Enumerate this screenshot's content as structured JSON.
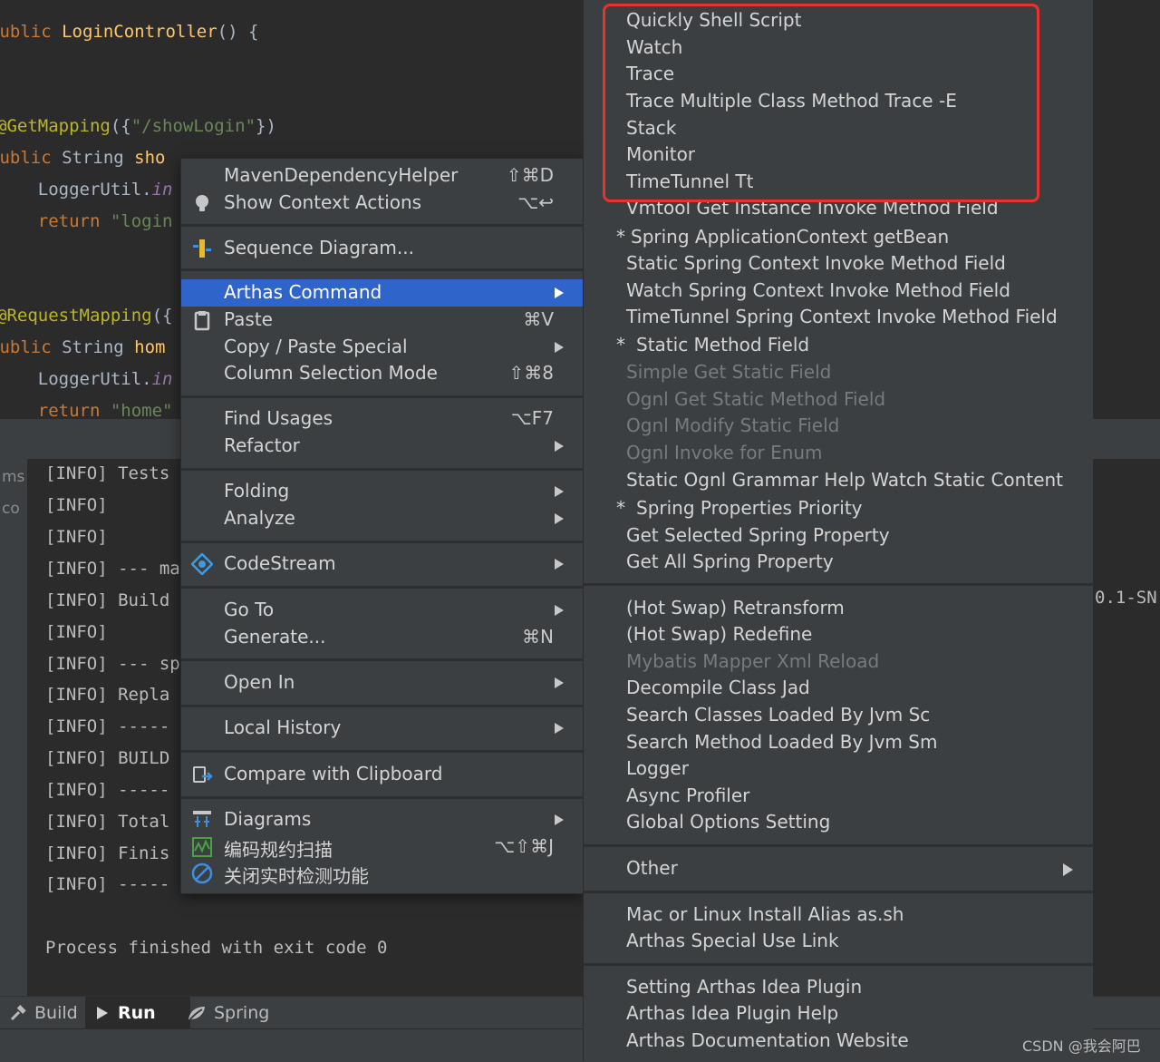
{
  "editor": {
    "lines": [
      {
        "a": "public ",
        "b": "LoginController",
        "c": "() {"
      },
      {
        "text": "}"
      },
      {
        "a": "@GetMapping",
        "b": "({",
        "c": "\"/showLogin\"",
        "d": "})"
      },
      {
        "a": "public ",
        "b": "String ",
        "c": "sho"
      },
      {
        "a": "    LoggerUtil.",
        "b": "in"
      },
      {
        "a": "    return ",
        "b": "\"login"
      },
      {
        "text": "}"
      },
      {
        "a": "@RequestMapping",
        "b": "({"
      },
      {
        "a": "public ",
        "b": "String ",
        "c": "hom"
      },
      {
        "a": "    LoggerUtil.",
        "b": "in"
      },
      {
        "a": "    return ",
        "b": "\"home\""
      }
    ]
  },
  "console": {
    "gutter": [
      "ms",
      "co"
    ],
    "lines": [
      "[INFO] Tests",
      "[INFO]",
      "[INFO]",
      "[INFO] --- ma",
      "[INFO] Build",
      "[INFO]",
      "[INFO] --- sp",
      "[INFO] Repla",
      "[INFO] -----",
      "[INFO] BUILD",
      "[INFO] -----",
      "[INFO] Total",
      "[INFO] Finis",
      "[INFO] -----"
    ],
    "trailing": "0.1-SN",
    "exit": "Process finished with exit code 0"
  },
  "toolbar": {
    "build": "Build",
    "run": "Run",
    "spring": "Spring"
  },
  "context_menu": {
    "items": [
      {
        "label": "MavenDependencyHelper",
        "shortcut": "⇧⌘D"
      },
      {
        "label": "Show Context Actions",
        "shortcut": "⌥↩",
        "icon": "lightbulb-icon"
      },
      {
        "label": "Sequence Diagram...",
        "icon": "sequence-diagram-icon"
      },
      {
        "label": "Arthas Command",
        "submenu": true,
        "selected": true
      },
      {
        "label": "Paste",
        "shortcut": "⌘V",
        "icon": "clipboard-icon"
      },
      {
        "label": "Copy / Paste Special",
        "submenu": true
      },
      {
        "label": "Column Selection Mode",
        "shortcut": "⇧⌘8"
      },
      {
        "label": "Find Usages",
        "shortcut": "⌥F7"
      },
      {
        "label": "Refactor",
        "submenu": true
      },
      {
        "label": "Folding",
        "submenu": true
      },
      {
        "label": "Analyze",
        "submenu": true
      },
      {
        "label": "CodeStream",
        "submenu": true,
        "icon": "codestream-icon"
      },
      {
        "label": "Go To",
        "submenu": true
      },
      {
        "label": "Generate...",
        "shortcut": "⌘N"
      },
      {
        "label": "Open In",
        "submenu": true
      },
      {
        "label": "Local History",
        "submenu": true
      },
      {
        "label": "Compare with Clipboard",
        "icon": "compare-clipboard-icon"
      },
      {
        "label": "Diagrams",
        "submenu": true,
        "icon": "diagrams-icon"
      },
      {
        "label": "编码规约扫描",
        "shortcut": "⌥⇧⌘J",
        "icon": "code-scan-icon"
      },
      {
        "label": "关闭实时检测功能",
        "icon": "disable-icon"
      }
    ]
  },
  "submenu": {
    "items": [
      {
        "label": "Quickly Shell Script"
      },
      {
        "label": "Watch"
      },
      {
        "label": "Trace"
      },
      {
        "label": "Trace Multiple Class Method Trace -E"
      },
      {
        "label": "Stack"
      },
      {
        "label": "Monitor"
      },
      {
        "label": "TimeTunnel Tt"
      },
      {
        "label": "Vmtool Get Instance Invoke Method Field"
      },
      {
        "label": "Spring ApplicationContext getBean",
        "star": "*"
      },
      {
        "label": "Static Spring Context Invoke  Method Field"
      },
      {
        "label": "Watch Spring Context Invoke Method Field"
      },
      {
        "label": "TimeTunnel Spring Context Invoke Method Field"
      },
      {
        "label": "Static Method Field",
        "star": "*"
      },
      {
        "label": "Simple Get Static Field",
        "disabled": true
      },
      {
        "label": "Ognl Get Static Method Field",
        "disabled": true
      },
      {
        "label": "Ognl Modify Static Field",
        "disabled": true
      },
      {
        "label": "Ognl Invoke for Enum",
        "disabled": true
      },
      {
        "label": "Static Ognl Grammar Help Watch Static Content"
      },
      {
        "label": "Spring Properties Priority",
        "star": "*"
      },
      {
        "label": "Get Selected Spring Property"
      },
      {
        "label": "Get All Spring Property"
      },
      {
        "label": "(Hot Swap) Retransform"
      },
      {
        "label": "(Hot Swap) Redefine"
      },
      {
        "label": "Mybatis Mapper Xml Reload",
        "disabled": true
      },
      {
        "label": "Decompile Class Jad"
      },
      {
        "label": "Search Classes Loaded By Jvm Sc"
      },
      {
        "label": "Search Method Loaded By Jvm Sm"
      },
      {
        "label": "Logger"
      },
      {
        "label": "Async Profiler"
      },
      {
        "label": "Global Options Setting"
      },
      {
        "label": "Other",
        "submenu": true
      },
      {
        "label": "Mac or Linux Install Alias as.sh"
      },
      {
        "label": "Arthas Special Use Link"
      },
      {
        "label": "Setting Arthas Idea Plugin"
      },
      {
        "label": "Arthas Idea Plugin Help"
      },
      {
        "label": "Arthas Documentation Website"
      }
    ]
  },
  "watermark": "CSDN @我会阿巴",
  "colors": {
    "selection": "#2f65ca",
    "highlight_box": "#e8322f",
    "menu_bg": "#3c3f41",
    "editor_bg": "#2b2b2b"
  }
}
